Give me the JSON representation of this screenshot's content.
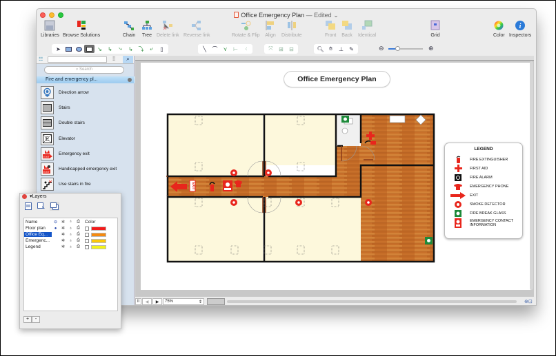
{
  "window": {
    "title": "Office Emergency Plan",
    "status_suffix": "— Edited",
    "chevron": "⌄"
  },
  "toolbar": {
    "buttons": [
      {
        "label": "Libraries",
        "icon": "libraries-icon",
        "enabled": true
      },
      {
        "label": "Browse Solutions",
        "icon": "browse-solutions-icon",
        "enabled": true
      },
      {
        "label": "Chain",
        "icon": "chain-icon",
        "enabled": true
      },
      {
        "label": "Tree",
        "icon": "tree-icon",
        "enabled": true
      },
      {
        "label": "Delete link",
        "icon": "delete-link-icon",
        "enabled": false
      },
      {
        "label": "Reverse link",
        "icon": "reverse-link-icon",
        "enabled": false
      },
      {
        "label": "Rotate & Flip",
        "icon": "rotate-flip-icon",
        "enabled": false
      },
      {
        "label": "Align",
        "icon": "align-icon",
        "enabled": false
      },
      {
        "label": "Distribute",
        "icon": "distribute-icon",
        "enabled": false
      },
      {
        "label": "Front",
        "icon": "front-icon",
        "enabled": false
      },
      {
        "label": "Back",
        "icon": "back-icon",
        "enabled": false
      },
      {
        "label": "Identical",
        "icon": "identical-icon",
        "enabled": false
      },
      {
        "label": "Grid",
        "icon": "grid-icon",
        "enabled": true
      },
      {
        "label": "Color",
        "icon": "color-wheel-icon",
        "enabled": true
      },
      {
        "label": "Inspectors",
        "icon": "info-icon",
        "enabled": true
      }
    ]
  },
  "library": {
    "search_placeholder": "Search",
    "section_title": "Fire and emergency pl...",
    "items": [
      {
        "label": "Direction arrow"
      },
      {
        "label": "Stairs"
      },
      {
        "label": "Double stairs"
      },
      {
        "label": "Elevator"
      },
      {
        "label": "Emergency exit"
      },
      {
        "label": "Handicapped emergency exit"
      },
      {
        "label": "Use stairs in fire"
      }
    ]
  },
  "canvas": {
    "diagram_title": "Office Emergency Plan",
    "exit_sign_text": "EXIT",
    "legend": {
      "title": "LEGEND",
      "items": [
        {
          "label": "FIRE EXTINGUISHER",
          "icon": "fire-extinguisher-icon"
        },
        {
          "label": "FIRST AID",
          "icon": "first-aid-icon"
        },
        {
          "label": "FIRE ALARM",
          "icon": "fire-alarm-icon"
        },
        {
          "label": "EMERGENCY PHONE",
          "icon": "emergency-phone-icon"
        },
        {
          "label": "EXIT",
          "icon": "exit-arrow-icon"
        },
        {
          "label": "SMOKE DETECTOR",
          "icon": "smoke-detector-icon"
        },
        {
          "label": "FIRE BREAK GLASS",
          "icon": "fire-break-glass-icon"
        },
        {
          "label": "EMERGENCY CONTACT INFORMATION",
          "icon": "emergency-contact-icon"
        }
      ]
    }
  },
  "statusbar": {
    "zoom": "75%"
  },
  "layers": {
    "title": "Layers",
    "columns": {
      "name": "Name",
      "color": "Color"
    },
    "rows": [
      {
        "name": "Floor plan",
        "color": "#f21a1a",
        "selected": false,
        "active": true
      },
      {
        "name": "Office Eq...",
        "color": "#f58a10",
        "selected": true,
        "active": false
      },
      {
        "name": "Emergenc...",
        "color": "#fbc80a",
        "selected": false,
        "active": false
      },
      {
        "name": "Legend",
        "color": "#f2f21a",
        "selected": false,
        "active": false
      }
    ],
    "add_label": "+",
    "remove_label": "-"
  }
}
